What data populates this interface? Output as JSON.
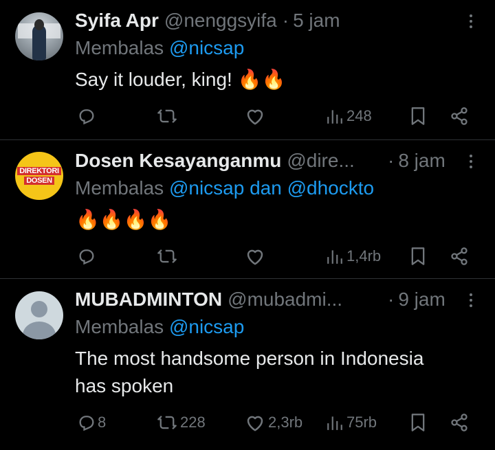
{
  "tweets": [
    {
      "name": "Syifa Apr",
      "handle": "@nenggsyifa",
      "time": "5 jam",
      "reply_prefix": "Membalas",
      "mention_1": "@nicsap",
      "text": "Say it louder, king!",
      "emoji": "🔥🔥",
      "views": "248"
    },
    {
      "name": "Dosen Kesayanganmu",
      "handle": "@dire...",
      "time": "8 jam",
      "reply_prefix": "Membalas",
      "mention_1": "@nicsap",
      "conjunction": "dan",
      "mention_2": "@dhockto",
      "emoji": "🔥🔥🔥🔥",
      "views": "1,4rb",
      "avatar_text_1": "DIREKTORI",
      "avatar_text_2": "DOSEN"
    },
    {
      "name": "MUBADMINTON",
      "handle": "@mubadmi...",
      "time": "9 jam",
      "reply_prefix": "Membalas",
      "mention_1": "@nicsap",
      "text_line_1": "The most handsome person in Indonesia",
      "text_line_2": "has spoken",
      "replies": "8",
      "retweets": "228",
      "likes": "2,3rb",
      "views": "75rb"
    }
  ],
  "separator": "·",
  "icons": [
    "reply-icon",
    "retweet-icon",
    "like-icon",
    "views-icon",
    "bookmark-icon",
    "share-icon",
    "more-icon"
  ],
  "colors": {
    "background": "#000000",
    "text": "#e7e9ea",
    "muted": "#71767b",
    "link": "#1d9bf0",
    "divider": "#2f3336"
  }
}
